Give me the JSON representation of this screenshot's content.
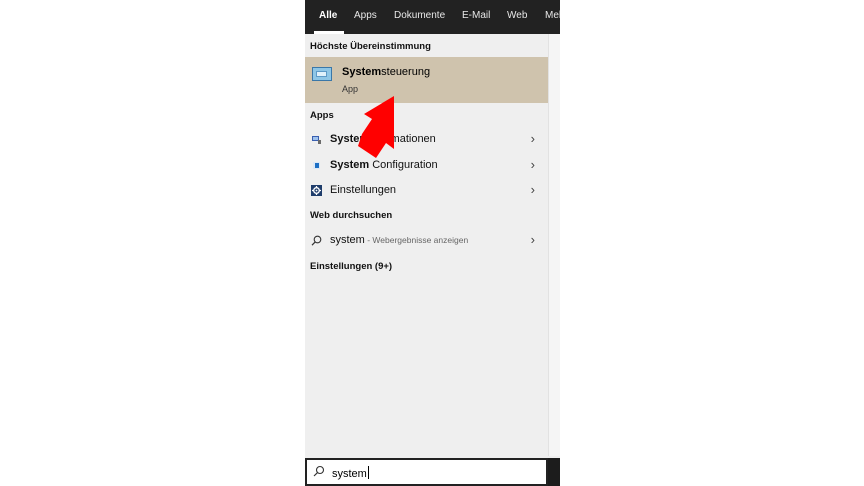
{
  "tabs": [
    {
      "label": "Alle",
      "active": true
    },
    {
      "label": "Apps",
      "active": false
    },
    {
      "label": "Dokumente",
      "active": false
    },
    {
      "label": "E-Mail",
      "active": false
    },
    {
      "label": "Web",
      "active": false
    },
    {
      "label": "Mel",
      "active": false
    }
  ],
  "best_match": {
    "heading": "Höchste Übereinstimmung",
    "title_bold": "System",
    "title_rest": "steuerung",
    "subtitle": "App",
    "icon": "control-panel-icon"
  },
  "apps": {
    "heading": "Apps",
    "items": [
      {
        "bold": "System",
        "rest": "informationen",
        "icon": "system-info-icon"
      },
      {
        "bold": "System",
        "rest": " Configuration",
        "icon": "system-config-icon"
      },
      {
        "bold": "",
        "rest": "Einstellungen",
        "icon": "settings-gear-icon"
      }
    ]
  },
  "web": {
    "heading": "Web durchsuchen",
    "query": "system",
    "hint": " - Webergebnisse anzeigen",
    "icon": "search-icon"
  },
  "settings_section": {
    "heading": "Einstellungen (9+)"
  },
  "search": {
    "value": "system",
    "icon": "search-icon"
  },
  "colors": {
    "highlight": "#cfc3ad",
    "topbar": "#222222",
    "annotation_arrow": "#ff0000"
  }
}
